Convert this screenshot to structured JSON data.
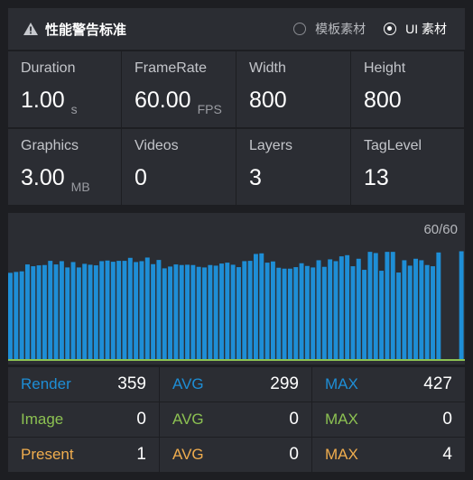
{
  "header": {
    "title": "性能警告标准",
    "icon": "warning-icon",
    "options": [
      {
        "label": "模板素材",
        "checked": false
      },
      {
        "label": "UI 素材",
        "checked": true
      }
    ]
  },
  "stats": [
    {
      "label": "Duration",
      "value": "1.00",
      "unit": "s"
    },
    {
      "label": "FrameRate",
      "value": "60.00",
      "unit": "FPS"
    },
    {
      "label": "Width",
      "value": "800",
      "unit": ""
    },
    {
      "label": "Height",
      "value": "800",
      "unit": ""
    },
    {
      "label": "Graphics",
      "value": "3.00",
      "unit": "MB"
    },
    {
      "label": "Videos",
      "value": "0",
      "unit": ""
    },
    {
      "label": "Layers",
      "value": "3",
      "unit": ""
    },
    {
      "label": "TagLevel",
      "value": "13",
      "unit": ""
    }
  ],
  "chart": {
    "counter": "60/60",
    "colors": {
      "bar": "#1e8ed6",
      "baseline": "#8cc152"
    },
    "ymax": 500,
    "frames": [
      288,
      291,
      293,
      316,
      310,
      313,
      314,
      328,
      316,
      327,
      306,
      324,
      306,
      318,
      315,
      313,
      327,
      329,
      325,
      328,
      328,
      338,
      324,
      327,
      339,
      317,
      331,
      303,
      309,
      316,
      314,
      315,
      314,
      308,
      306,
      314,
      312,
      319,
      322,
      315,
      307,
      327,
      328,
      351,
      353,
      322,
      326,
      305,
      302,
      302,
      307,
      320,
      311,
      306,
      330,
      308,
      333,
      327,
      343,
      347,
      310,
      335,
      298,
      358,
      354,
      295,
      358,
      358,
      289,
      330,
      312,
      335,
      330,
      314,
      310,
      356,
      0,
      0,
      0,
      360
    ]
  },
  "metrics": [
    {
      "label": "Render",
      "value": "359",
      "color": "#1e8ed6"
    },
    {
      "label": "AVG",
      "value": "299",
      "color": "#1e8ed6"
    },
    {
      "label": "MAX",
      "value": "427",
      "color": "#1e8ed6"
    },
    {
      "label": "Image",
      "value": "0",
      "color": "#8cc152"
    },
    {
      "label": "AVG",
      "value": "0",
      "color": "#8cc152"
    },
    {
      "label": "MAX",
      "value": "0",
      "color": "#8cc152"
    },
    {
      "label": "Present",
      "value": "1",
      "color": "#f0ad4e"
    },
    {
      "label": "AVG",
      "value": "0",
      "color": "#f0ad4e"
    },
    {
      "label": "MAX",
      "value": "4",
      "color": "#f0ad4e"
    }
  ]
}
